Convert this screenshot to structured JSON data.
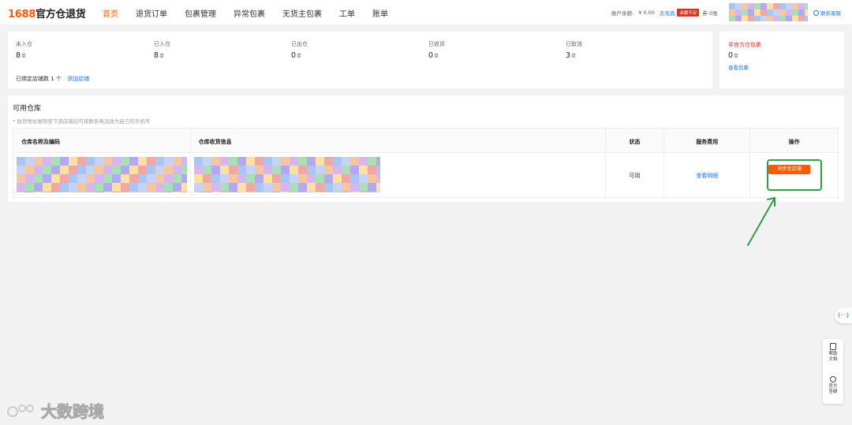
{
  "brand": {
    "num": "1688",
    "name": "官方仓退货"
  },
  "nav": [
    "首页",
    "退货订单",
    "包裹管理",
    "异常包裹",
    "无货主包裹",
    "工单",
    "账单"
  ],
  "account": {
    "balance_label": "账户余额:",
    "balance_value": "¥ 0.00",
    "recharge_link": "去充值",
    "badge": "余额不足",
    "coupon": "券 0张"
  },
  "contact_label": "联系客服",
  "stats": [
    {
      "label": "未入仓",
      "value": "8",
      "unit": "单"
    },
    {
      "label": "已入仓",
      "value": "8",
      "unit": "单"
    },
    {
      "label": "已出仓",
      "value": "0",
      "unit": "单"
    },
    {
      "label": "已收货",
      "value": "0",
      "unit": "单"
    },
    {
      "label": "已取消",
      "value": "3",
      "unit": "单"
    }
  ],
  "bound_shops": {
    "text": "已绑定店铺数 1 个",
    "add_link": "添加店铺"
  },
  "non_official": {
    "title": "非官方仓包裹",
    "value": "0",
    "unit": "单",
    "link": "查看包裹"
  },
  "warehouse": {
    "title": "可用仓库",
    "note": "* 收货地址复制至下游店铺后可将联系电话改为自己的手机号",
    "columns": [
      "仓库名称及编码",
      "仓库收货信息",
      "状态",
      "服务费用",
      "操作"
    ],
    "rows": [
      {
        "status": "可用",
        "fee_link": "查看明细",
        "action": "同步至店铺"
      }
    ]
  },
  "float_tab": "{···}",
  "side": [
    "帮助文档",
    "官方答疑"
  ],
  "watermark": "大数跨境",
  "colors": {
    "accent": "#ff5a00",
    "link": "#1677ff",
    "highlight": "#2ea043",
    "alert": "#e0301e"
  }
}
